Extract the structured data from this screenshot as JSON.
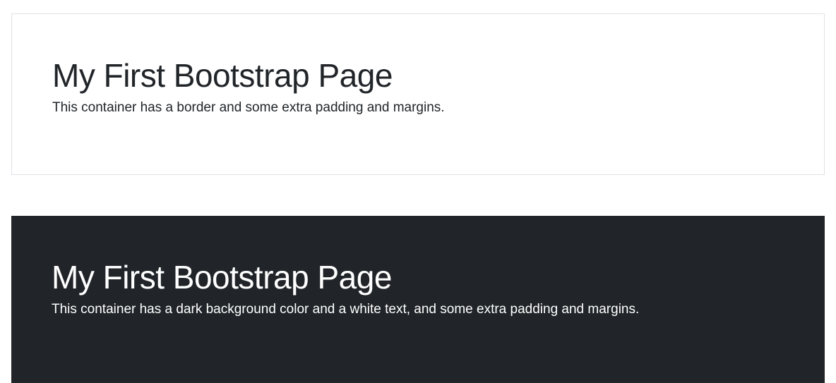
{
  "light_section": {
    "heading": "My First Bootstrap Page",
    "text": "This container has a border and some extra padding and margins."
  },
  "dark_section": {
    "heading": "My First Bootstrap Page",
    "text": "This container has a dark background color and a white text, and some extra padding and margins."
  },
  "colors": {
    "dark_background": "#212529",
    "border": "#dee2e6",
    "text_dark": "#212529",
    "text_light": "#ffffff"
  }
}
